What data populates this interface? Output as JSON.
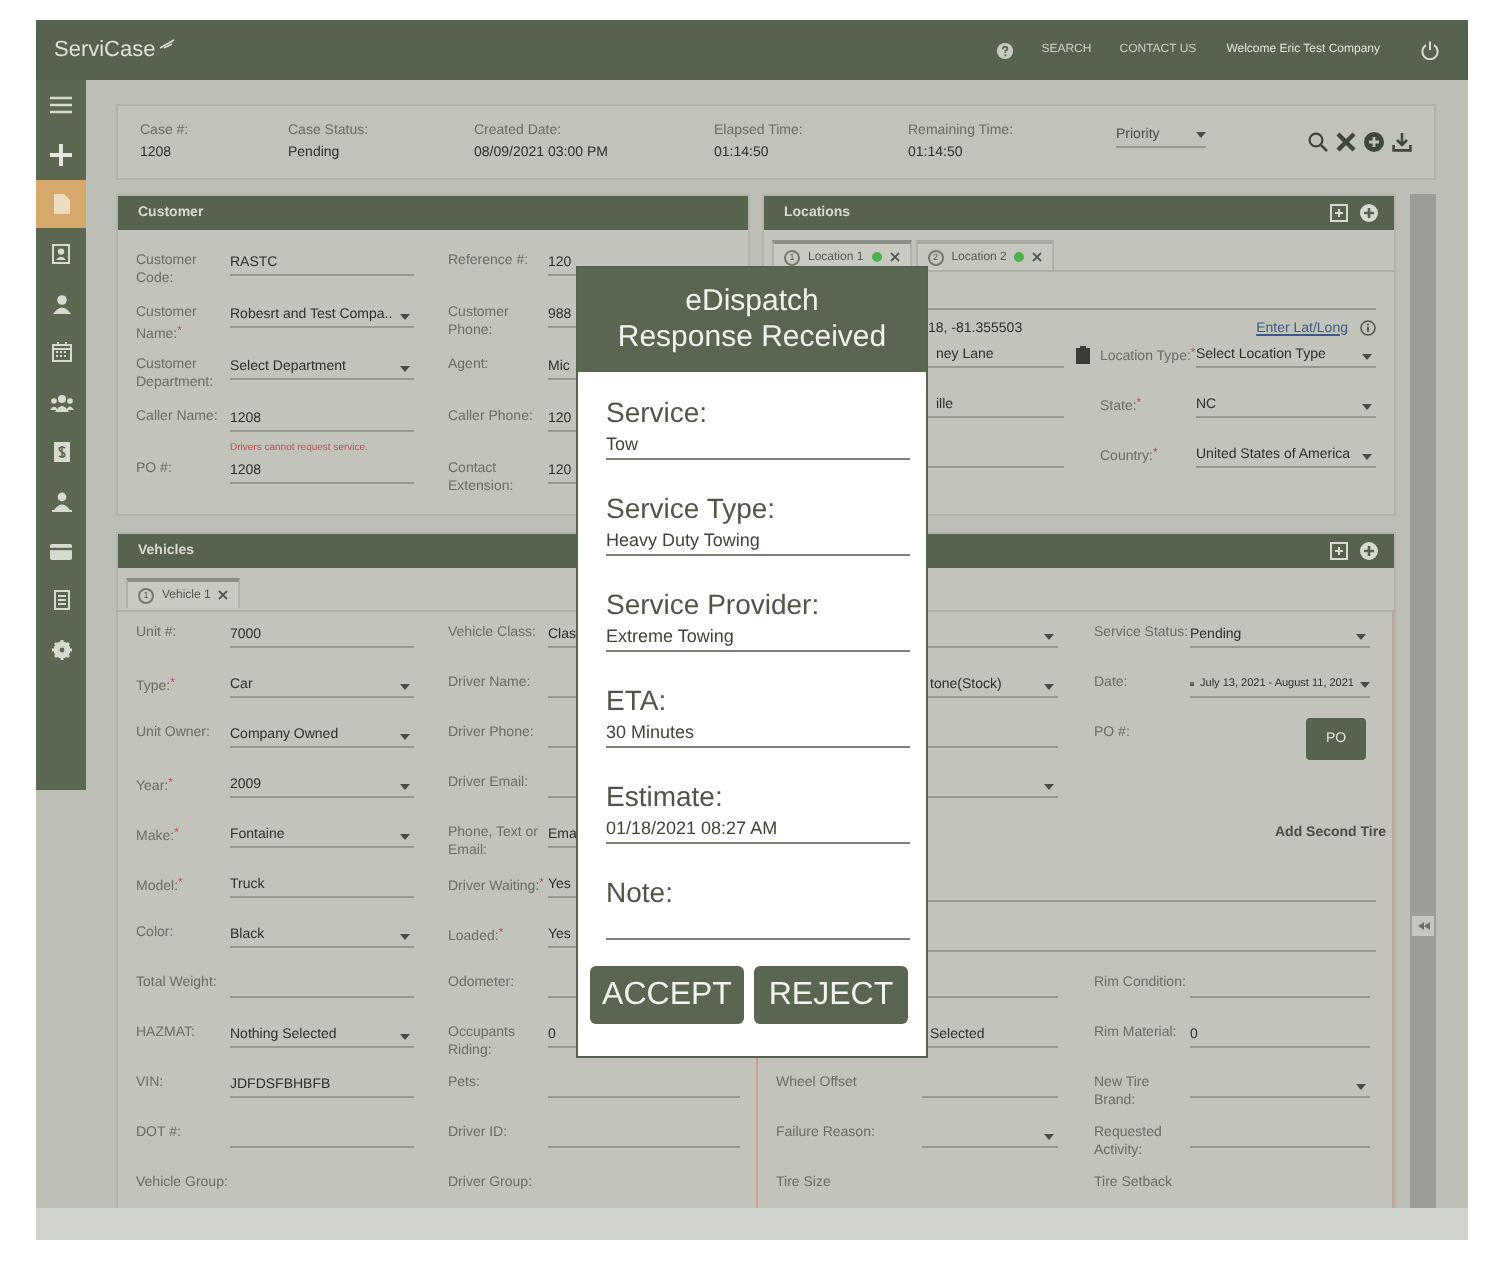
{
  "header": {
    "logo": "ServiCase",
    "links": [
      "SEARCH",
      "CONTACT US"
    ],
    "welcome": "Welcome Eric Test Company"
  },
  "sidebar": {
    "items": [
      {
        "kind": "menu",
        "selected": false
      },
      {
        "kind": "plus",
        "selected": false
      },
      {
        "kind": "document",
        "selected": true
      },
      {
        "kind": "contact",
        "selected": false
      },
      {
        "kind": "person",
        "selected": false
      },
      {
        "kind": "calendar",
        "selected": false
      },
      {
        "kind": "group",
        "selected": false
      },
      {
        "kind": "invoice",
        "selected": false
      },
      {
        "kind": "payee",
        "selected": false
      },
      {
        "kind": "card",
        "selected": false
      },
      {
        "kind": "form",
        "selected": false
      },
      {
        "kind": "gear",
        "selected": false
      }
    ]
  },
  "case_bar": {
    "fields": [
      {
        "label": "Case #:",
        "value": "1208"
      },
      {
        "label": "Case Status:",
        "value": "Pending"
      },
      {
        "label": "Created Date:",
        "value": "08/09/2021 03:00 PM"
      },
      {
        "label": "Elapsed Time:",
        "value": "01:14:50"
      },
      {
        "label": "Remaining Time:",
        "value": "01:14:50"
      }
    ],
    "priority": {
      "placeholder": "Priority"
    }
  },
  "customer": {
    "title": "Customer",
    "rows": [
      {
        "kind": "pair",
        "cells": [
          {
            "label": "Customer Code:",
            "value": "RASTC",
            "kind": "text"
          },
          {
            "label": "Reference #:",
            "value": "120",
            "kind": "text"
          }
        ]
      },
      {
        "kind": "pair",
        "cells": [
          {
            "label": "Customer Name:$^{*}$",
            "value": "Robesrt and Test Compa..",
            "kind": "select"
          },
          {
            "label": "Customer Phone:",
            "value": "988",
            "kind": "text"
          }
        ]
      },
      {
        "kind": "pair",
        "cells": [
          {
            "label": "Customer Department:",
            "value": "Select Department",
            "kind": "select"
          },
          {
            "label": "Agent:",
            "value": "Mic",
            "kind": "text"
          }
        ]
      },
      {
        "kind": "pair",
        "cells": [
          {
            "label": "Caller Name:",
            "value": "1208",
            "kind": "text",
            "error": "Drivers cannot request service."
          },
          {
            "label": "Caller Phone:",
            "value": "120",
            "kind": "text"
          }
        ]
      },
      {
        "kind": "pair",
        "cells": [
          {
            "label": "PO #:",
            "value": "1208",
            "kind": "text"
          },
          {
            "label": "Contact Extension:",
            "value": "120",
            "kind": "text"
          }
        ]
      }
    ]
  },
  "locations": {
    "title": "Locations",
    "tabs": [
      {
        "number": "1",
        "label": "Location 1",
        "color": "#4caf50",
        "selected": true
      },
      {
        "number": "2",
        "label": "Location 2",
        "color": "#4caf50",
        "selected": false
      }
    ],
    "rows": [
      {
        "kind": "line"
      },
      {
        "kind": "coords",
        "value": "18, -81.355503",
        "link": "Enter Lat/Long"
      },
      {
        "kind": "pair",
        "cells": [
          {
            "value": "ney Lane",
            "kind": "address"
          },
          {
            "label": "Location Type:$^{*}$",
            "value": "Select Location Type",
            "kind": "select"
          }
        ]
      },
      {
        "kind": "pair",
        "cells": [
          {
            "value": "ille",
            "kind": "text"
          },
          {
            "label": "State:$^{*}$",
            "value": "NC",
            "kind": "select"
          }
        ]
      },
      {
        "kind": "pair",
        "cells": [
          {
            "kind": "text"
          },
          {
            "label": "Country:$^{*}$",
            "value": "United States of America",
            "kind": "select"
          }
        ]
      }
    ]
  },
  "vehicles": {
    "title": "Vehicles",
    "tabs": [
      {
        "number": "1",
        "label": "Vehicle 1",
        "selected": true
      }
    ],
    "left_rows": [
      {
        "kind": "pair",
        "cells": [
          {
            "label": "Unit #:",
            "value": "7000",
            "kind": "text"
          },
          {
            "label": "Vehicle Class:",
            "value": "Clas",
            "kind": "text"
          }
        ]
      },
      {
        "kind": "pair",
        "cells": [
          {
            "label": "Type:$^{*}$",
            "value": "Car",
            "kind": "select"
          },
          {
            "label": "Driver Name:",
            "kind": "text"
          }
        ]
      },
      {
        "kind": "pair",
        "cells": [
          {
            "label": "Unit Owner:",
            "value": "Company Owned",
            "kind": "select"
          },
          {
            "label": "Driver Phone:",
            "kind": "text"
          }
        ]
      },
      {
        "kind": "pair",
        "cells": [
          {
            "label": "Year:$^{*}$",
            "value": "2009",
            "kind": "select"
          },
          {
            "label": "Driver Email:",
            "kind": "text"
          }
        ]
      },
      {
        "kind": "pair",
        "cells": [
          {
            "label": "Make:$^{*}$",
            "value": "Fontaine",
            "kind": "select"
          },
          {
            "label": "Phone, Text or Email:",
            "value": "Ema",
            "kind": "text"
          }
        ]
      },
      {
        "kind": "pair",
        "cells": [
          {
            "label": "Model:$^{*}$",
            "value": "Truck",
            "kind": "text"
          },
          {
            "label": "Driver Waiting:$^{*}$",
            "value": "Yes",
            "kind": "text"
          }
        ]
      },
      {
        "kind": "pair",
        "cells": [
          {
            "label": "Color:",
            "value": "Black",
            "kind": "select"
          },
          {
            "label": "Loaded:$^{*}$",
            "value": "Yes",
            "kind": "text"
          }
        ]
      },
      {
        "kind": "pair",
        "cells": [
          {
            "label": "Total Weight:",
            "kind": "text"
          },
          {
            "label": "Odometer:",
            "kind": "text"
          }
        ]
      },
      {
        "kind": "pair",
        "cells": [
          {
            "label": "HAZMAT:",
            "value": "Nothing Selected",
            "kind": "select"
          },
          {
            "label": "Occupants Riding:",
            "value": "0",
            "kind": "text"
          }
        ]
      },
      {
        "kind": "pair",
        "cells": [
          {
            "label": "VIN:",
            "value": "JDFDSFBHBFB",
            "kind": "text"
          },
          {
            "label": "Pets:",
            "kind": "text"
          }
        ]
      },
      {
        "kind": "pair",
        "cells": [
          {
            "label": "DOT #:",
            "kind": "text"
          },
          {
            "label": "Driver ID:",
            "kind": "text"
          }
        ]
      },
      {
        "kind": "pair",
        "cells": [
          {
            "label": "Vehicle Group:",
            "kind": "none"
          },
          {
            "label": "Driver Group:",
            "kind": "none"
          }
        ]
      }
    ],
    "right_rows": [
      {
        "kind": "pair",
        "cells": [
          {
            "kind": "select"
          },
          {
            "label": "Service Status:",
            "value": "Pending",
            "kind": "select"
          }
        ]
      },
      {
        "kind": "pair",
        "cells": [
          {
            "value": "tone(Stock)",
            "kind": "select"
          },
          {
            "label": "Date:",
            "value": "July 13, 2021 - August 11, 2021",
            "kind": "date"
          }
        ]
      },
      {
        "kind": "pair",
        "cells": [
          {
            "kind": "text"
          },
          {
            "label": "PO #:",
            "value": "PO",
            "kind": "button"
          }
        ]
      },
      {
        "kind": "pair",
        "cells": [
          {
            "kind": "select"
          },
          {
            "kind": "none"
          }
        ]
      },
      {
        "kind": "pair",
        "cells": [
          {
            "kind": "none"
          },
          {
            "value": "Add Second Tire",
            "kind": "action"
          }
        ]
      },
      {
        "kind": "line"
      },
      {
        "kind": "line"
      },
      {
        "kind": "pair",
        "cells": [
          {
            "kind": "text"
          },
          {
            "label": "Rim Condition:",
            "kind": "text"
          }
        ]
      },
      {
        "kind": "pair",
        "cells": [
          {
            "value": "Selected",
            "kind": "text"
          },
          {
            "label": "Rim Material:",
            "value": "0",
            "kind": "text"
          }
        ]
      },
      {
        "kind": "pair",
        "cells": [
          {
            "label": "Wheel Offset",
            "kind": "text"
          },
          {
            "label": "New Tire Brand:",
            "kind": "select"
          }
        ]
      },
      {
        "kind": "pair",
        "cells": [
          {
            "label": "Failure Reason:",
            "kind": "select"
          },
          {
            "label": "Requested Activity:",
            "kind": "text"
          }
        ]
      },
      {
        "kind": "pair",
        "cells": [
          {
            "label": "Tire Size",
            "kind": "none"
          },
          {
            "label": "Tire Setback",
            "kind": "none"
          }
        ]
      }
    ]
  },
  "modal": {
    "title_lines": [
      "eDispatch",
      "Response Received"
    ],
    "fields": [
      {
        "label": "Service:",
        "value": "Tow"
      },
      {
        "label": "Service Type:",
        "value": "Heavy Duty Towing"
      },
      {
        "label": "Service Provider:",
        "value": "Extreme Towing"
      },
      {
        "label": "ETA:",
        "value": "30 Minutes"
      },
      {
        "label": "Estimate:",
        "value": "01/18/2021  08:27 AM"
      },
      {
        "label": "Note:"
      }
    ],
    "buttons": [
      "ACCEPT",
      "REJECT"
    ]
  }
}
